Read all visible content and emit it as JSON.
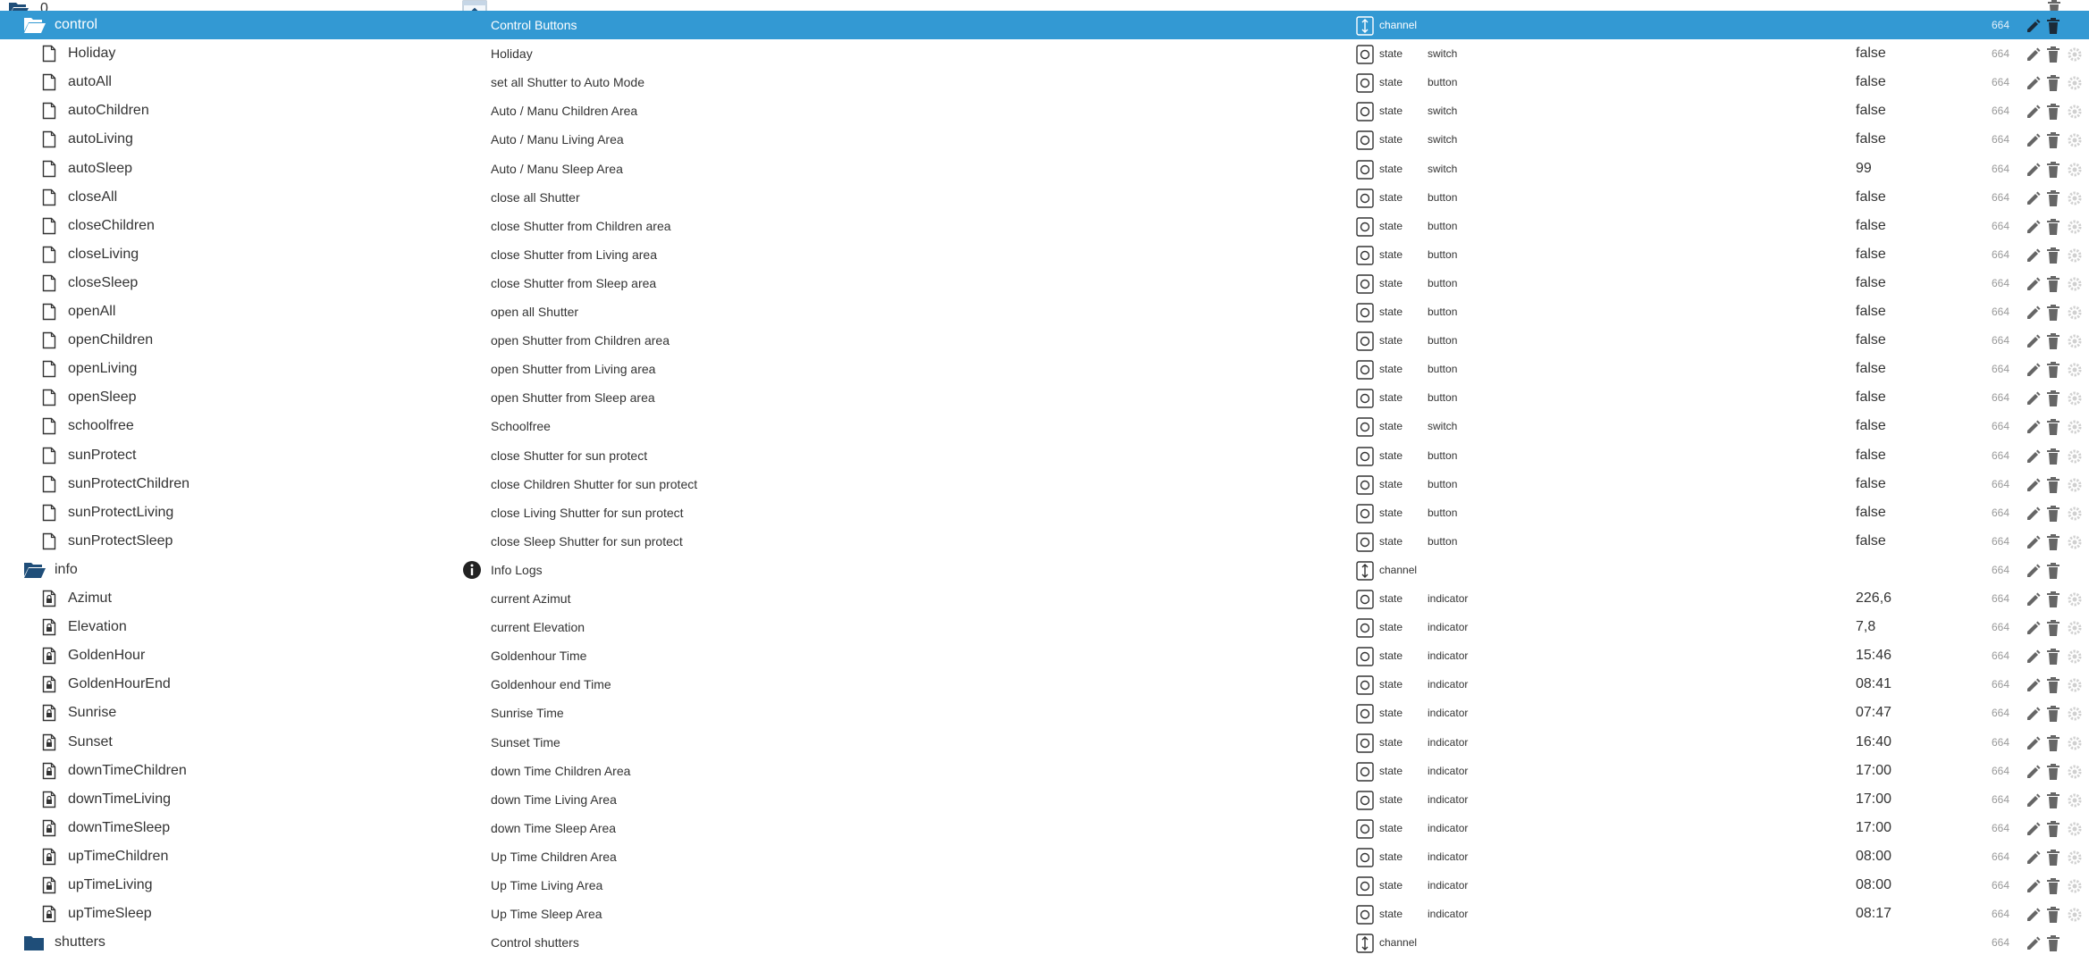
{
  "colors": {
    "selected_bg": "#3399d3",
    "folder": "#1f4e79",
    "icon": "#333333",
    "acl": "#999999",
    "disabled": "#d0d0d0"
  },
  "top": {
    "label": "0",
    "dots": "..."
  },
  "rows": [
    {
      "name": "control",
      "kind": "folder",
      "indent": 1,
      "desc": "Control Buttons",
      "type": "channel",
      "role": "",
      "value": "",
      "acl": "664",
      "selected": true
    },
    {
      "name": "Holiday",
      "kind": "file",
      "indent": 2,
      "desc": "Holiday",
      "type": "state",
      "role": "switch",
      "value": "false",
      "acl": "664"
    },
    {
      "name": "autoAll",
      "kind": "file",
      "indent": 2,
      "desc": "set all Shutter to Auto Mode",
      "type": "state",
      "role": "button",
      "value": "false",
      "acl": "664"
    },
    {
      "name": "autoChildren",
      "kind": "file",
      "indent": 2,
      "desc": "Auto / Manu Children Area",
      "type": "state",
      "role": "switch",
      "value": "false",
      "acl": "664"
    },
    {
      "name": "autoLiving",
      "kind": "file",
      "indent": 2,
      "desc": "Auto / Manu Living Area",
      "type": "state",
      "role": "switch",
      "value": "false",
      "acl": "664"
    },
    {
      "name": "autoSleep",
      "kind": "file",
      "indent": 2,
      "desc": "Auto / Manu Sleep Area",
      "type": "state",
      "role": "switch",
      "value": "99",
      "acl": "664"
    },
    {
      "name": "closeAll",
      "kind": "file",
      "indent": 2,
      "desc": "close all Shutter",
      "type": "state",
      "role": "button",
      "value": "false",
      "acl": "664"
    },
    {
      "name": "closeChildren",
      "kind": "file",
      "indent": 2,
      "desc": "close Shutter from Children area",
      "type": "state",
      "role": "button",
      "value": "false",
      "acl": "664"
    },
    {
      "name": "closeLiving",
      "kind": "file",
      "indent": 2,
      "desc": "close Shutter from Living area",
      "type": "state",
      "role": "button",
      "value": "false",
      "acl": "664"
    },
    {
      "name": "closeSleep",
      "kind": "file",
      "indent": 2,
      "desc": "close Shutter from Sleep area",
      "type": "state",
      "role": "button",
      "value": "false",
      "acl": "664"
    },
    {
      "name": "openAll",
      "kind": "file",
      "indent": 2,
      "desc": "open all Shutter",
      "type": "state",
      "role": "button",
      "value": "false",
      "acl": "664"
    },
    {
      "name": "openChildren",
      "kind": "file",
      "indent": 2,
      "desc": "open Shutter from Children area",
      "type": "state",
      "role": "button",
      "value": "false",
      "acl": "664"
    },
    {
      "name": "openLiving",
      "kind": "file",
      "indent": 2,
      "desc": "open Shutter from Living area",
      "type": "state",
      "role": "button",
      "value": "false",
      "acl": "664"
    },
    {
      "name": "openSleep",
      "kind": "file",
      "indent": 2,
      "desc": "open Shutter from Sleep area",
      "type": "state",
      "role": "button",
      "value": "false",
      "acl": "664"
    },
    {
      "name": "schoolfree",
      "kind": "file",
      "indent": 2,
      "desc": "Schoolfree",
      "type": "state",
      "role": "switch",
      "value": "false",
      "acl": "664"
    },
    {
      "name": "sunProtect",
      "kind": "file",
      "indent": 2,
      "desc": "close Shutter for sun protect",
      "type": "state",
      "role": "button",
      "value": "false",
      "acl": "664"
    },
    {
      "name": "sunProtectChildren",
      "kind": "file",
      "indent": 2,
      "desc": "close Children Shutter for sun protect",
      "type": "state",
      "role": "button",
      "value": "false",
      "acl": "664"
    },
    {
      "name": "sunProtectLiving",
      "kind": "file",
      "indent": 2,
      "desc": "close Living Shutter for sun protect",
      "type": "state",
      "role": "button",
      "value": "false",
      "acl": "664"
    },
    {
      "name": "sunProtectSleep",
      "kind": "file",
      "indent": 2,
      "desc": "close Sleep Shutter for sun protect",
      "type": "state",
      "role": "button",
      "value": "false",
      "acl": "664"
    },
    {
      "name": "info",
      "kind": "folder",
      "indent": 1,
      "desc": "Info Logs",
      "type": "channel",
      "role": "",
      "value": "",
      "acl": "664",
      "info": true
    },
    {
      "name": "Azimut",
      "kind": "locked",
      "indent": 2,
      "desc": "current Azimut",
      "type": "state",
      "role": "indicator",
      "value": "226,6",
      "acl": "664"
    },
    {
      "name": "Elevation",
      "kind": "locked",
      "indent": 2,
      "desc": "current Elevation",
      "type": "state",
      "role": "indicator",
      "value": "7,8",
      "acl": "664"
    },
    {
      "name": "GoldenHour",
      "kind": "locked",
      "indent": 2,
      "desc": "Goldenhour Time",
      "type": "state",
      "role": "indicator",
      "value": "15:46",
      "acl": "664"
    },
    {
      "name": "GoldenHourEnd",
      "kind": "locked",
      "indent": 2,
      "desc": "Goldenhour end Time",
      "type": "state",
      "role": "indicator",
      "value": "08:41",
      "acl": "664"
    },
    {
      "name": "Sunrise",
      "kind": "locked",
      "indent": 2,
      "desc": "Sunrise Time",
      "type": "state",
      "role": "indicator",
      "value": "07:47",
      "acl": "664"
    },
    {
      "name": "Sunset",
      "kind": "locked",
      "indent": 2,
      "desc": "Sunset Time",
      "type": "state",
      "role": "indicator",
      "value": "16:40",
      "acl": "664"
    },
    {
      "name": "downTimeChildren",
      "kind": "locked",
      "indent": 2,
      "desc": "down Time Children Area",
      "type": "state",
      "role": "indicator",
      "value": "17:00",
      "acl": "664"
    },
    {
      "name": "downTimeLiving",
      "kind": "locked",
      "indent": 2,
      "desc": "down Time Living Area",
      "type": "state",
      "role": "indicator",
      "value": "17:00",
      "acl": "664"
    },
    {
      "name": "downTimeSleep",
      "kind": "locked",
      "indent": 2,
      "desc": "down Time Sleep Area",
      "type": "state",
      "role": "indicator",
      "value": "17:00",
      "acl": "664"
    },
    {
      "name": "upTimeChildren",
      "kind": "locked",
      "indent": 2,
      "desc": "Up Time Children Area",
      "type": "state",
      "role": "indicator",
      "value": "08:00",
      "acl": "664"
    },
    {
      "name": "upTimeLiving",
      "kind": "locked",
      "indent": 2,
      "desc": "Up Time Living Area",
      "type": "state",
      "role": "indicator",
      "value": "08:00",
      "acl": "664"
    },
    {
      "name": "upTimeSleep",
      "kind": "locked",
      "indent": 2,
      "desc": "Up Time Sleep Area",
      "type": "state",
      "role": "indicator",
      "value": "08:17",
      "acl": "664"
    },
    {
      "name": "shutters",
      "kind": "folder-closed",
      "indent": 1,
      "desc": "Control shutters",
      "type": "channel",
      "role": "",
      "value": "",
      "acl": "664"
    }
  ]
}
